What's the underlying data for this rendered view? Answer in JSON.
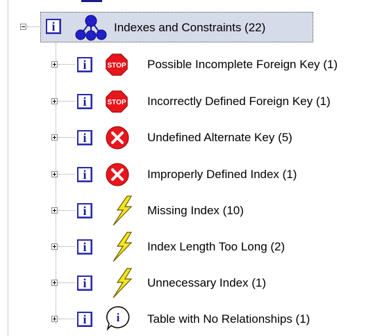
{
  "tree": {
    "root": {
      "label": "Indexes and Constraints (22)",
      "expanded": true,
      "icon": "index-group-icon",
      "selected": true
    },
    "children": [
      {
        "label": "Possible Incomplete Foreign Key (1)",
        "icon": "stop-sign-icon",
        "stop_text": "STOP"
      },
      {
        "label": "Incorrectly Defined Foreign Key (1)",
        "icon": "stop-sign-icon",
        "stop_text": "STOP"
      },
      {
        "label": "Undefined Alternate Key (5)",
        "icon": "error-x-icon"
      },
      {
        "label": "Improperly Defined Index (1)",
        "icon": "error-x-icon"
      },
      {
        "label": "Missing Index (10)",
        "icon": "lightning-warning-icon"
      },
      {
        "label": "Index Length Too Long (2)",
        "icon": "lightning-warning-icon"
      },
      {
        "label": "Unnecessary Index (1)",
        "icon": "lightning-warning-icon"
      },
      {
        "label": "Table with No Relationships (1)",
        "icon": "info-bubble-icon"
      }
    ],
    "info_glyph": "i"
  },
  "colors": {
    "selection": "#d6dbe9",
    "stop_red": "#e8161c",
    "error_red": "#e8161c",
    "lightning_yellow": "#f2e51e",
    "info_blue": "#1a1a9a"
  }
}
